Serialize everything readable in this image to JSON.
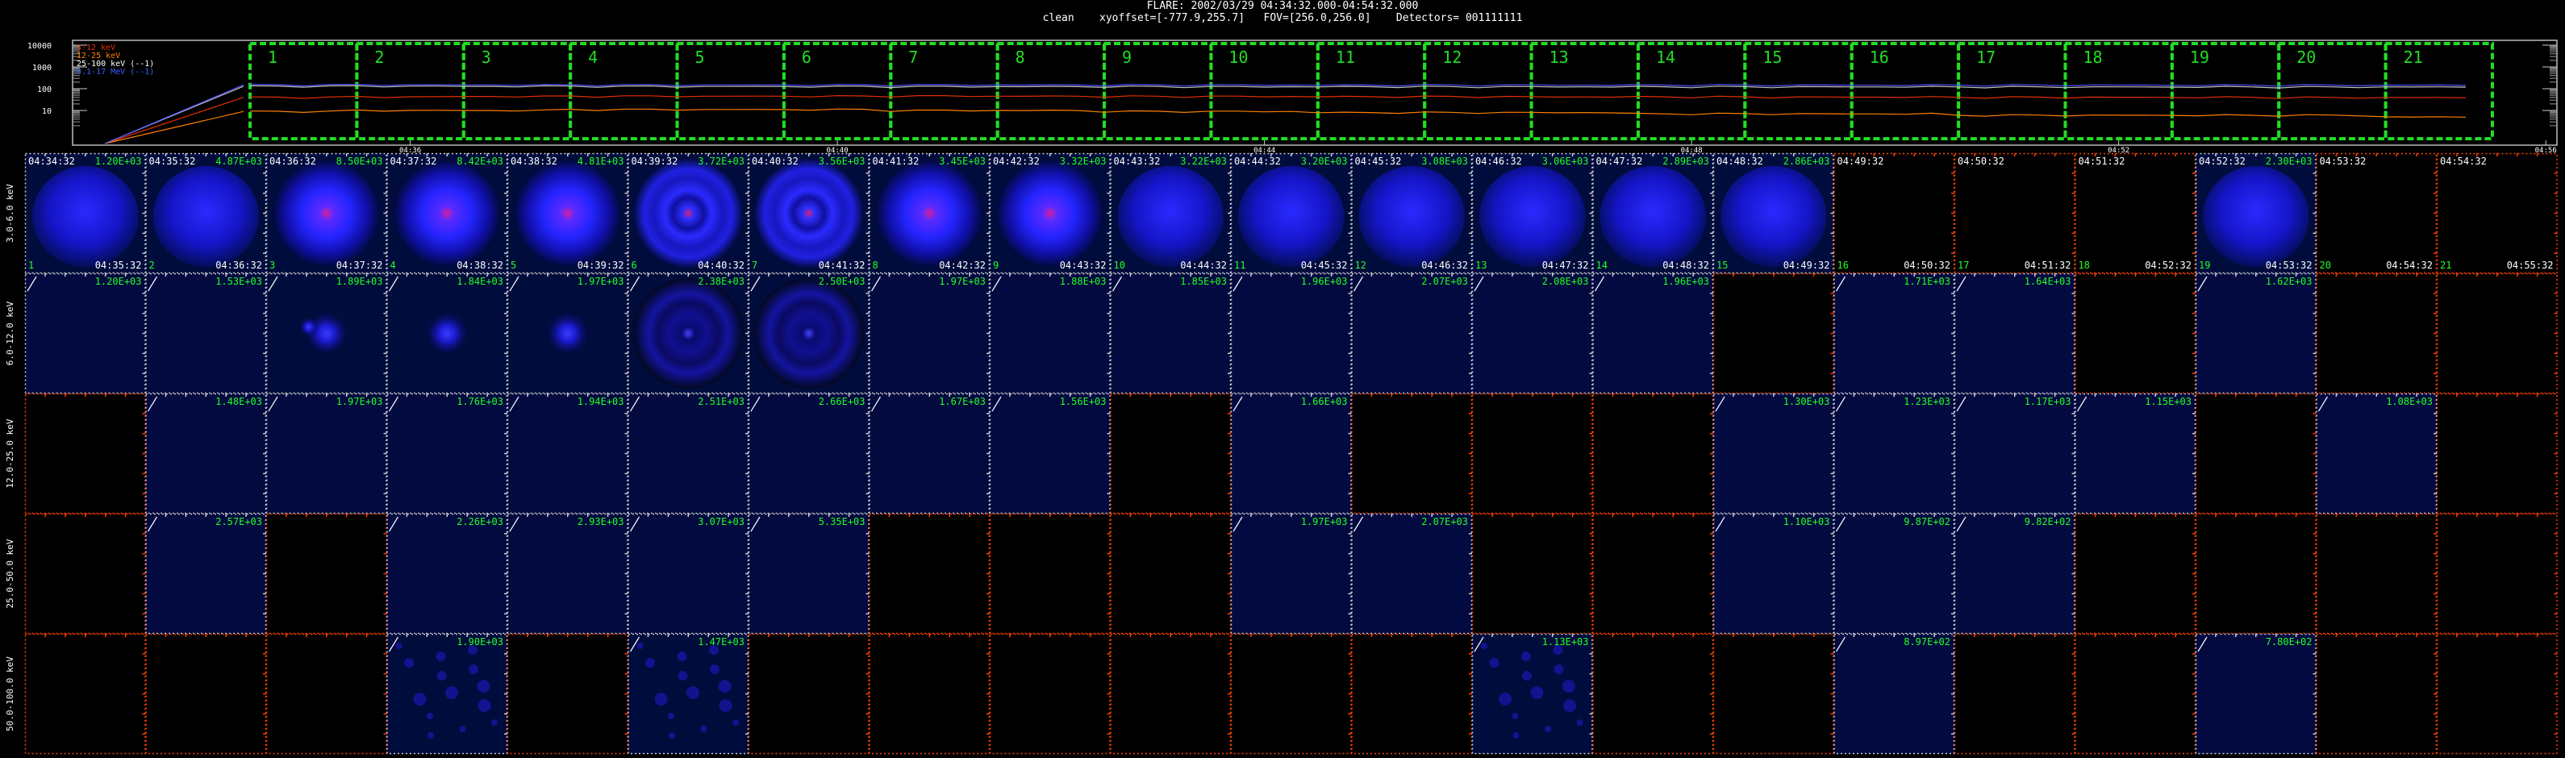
{
  "header": {
    "title": "FLARE: 2002/03/29 04:34:32.000-04:54:32.000",
    "subtitle": "clean    xyoffset=[-777.9,255.7]   FOV=[256.0,256.0]    Detectors= 001111111"
  },
  "lightcurve": {
    "y_ticks": [
      "10000",
      "1000",
      "100",
      "10"
    ],
    "legend": [
      {
        "label": "3-12 keV",
        "color": "#e03000"
      },
      {
        "label": "12-25 keV",
        "color": "#ff8000"
      },
      {
        "label": "25-100 keV (--1)",
        "color": "#ffffff"
      },
      {
        "label": "0.1-17 MeV (--1)",
        "color": "#3060ff"
      }
    ],
    "time_ticks": [
      "04:36",
      "04:40",
      "04:44",
      "04:48",
      "04:52",
      "04:56"
    ],
    "intervals": [
      "1",
      "2",
      "3",
      "4",
      "5",
      "6",
      "7",
      "8",
      "9",
      "10",
      "11",
      "12",
      "13",
      "14",
      "15",
      "16",
      "17",
      "18",
      "19",
      "20",
      "21"
    ],
    "series": [
      {
        "name": "3-12 keV",
        "color": "#e03000",
        "values": [
          40,
          42,
          44,
          45,
          45,
          45,
          46,
          45,
          44,
          44,
          43,
          43,
          42,
          42,
          41,
          41,
          40,
          40,
          40,
          39,
          39
        ]
      },
      {
        "name": "12-25 keV",
        "color": "#ff8000",
        "values": [
          9,
          10,
          10,
          11,
          11,
          11,
          10,
          10,
          9,
          9,
          8,
          8,
          8,
          7,
          7,
          7,
          6,
          6,
          6,
          6,
          5
        ]
      },
      {
        "name": "25-100 keV",
        "color": "#c0c0c0",
        "values": [
          130,
          130,
          128,
          128,
          126,
          126,
          125,
          124,
          124,
          123,
          123,
          122,
          122,
          122,
          121,
          121,
          120,
          120,
          120,
          119,
          119
        ]
      },
      {
        "name": "0.1-17 MeV",
        "color": "#5050ff",
        "values": [
          150,
          150,
          149,
          149,
          148,
          148,
          148,
          147,
          147,
          147,
          146,
          146,
          146,
          146,
          145,
          145,
          145,
          145,
          144,
          144,
          144
        ]
      }
    ]
  },
  "bands": [
    "3.0-6.0 keV",
    "6.0-12.0 keV",
    "12.0-25.0 keV",
    "25.0-50.0 keV",
    "50.0-100.0 keV"
  ],
  "time_starts": [
    "04:34:32",
    "04:35:32",
    "04:36:32",
    "04:37:32",
    "04:38:32",
    "04:39:32",
    "04:40:32",
    "04:41:32",
    "04:42:32",
    "04:43:32",
    "04:44:32",
    "04:45:32",
    "04:46:32",
    "04:47:32",
    "04:48:32",
    "04:49:32",
    "04:50:32",
    "04:51:32",
    "04:52:32",
    "04:53:32",
    "04:54:32"
  ],
  "time_ends": [
    "04:35:32",
    "04:36:32",
    "04:37:32",
    "04:38:32",
    "04:39:32",
    "04:40:32",
    "04:41:32",
    "04:42:32",
    "04:43:32",
    "04:44:32",
    "04:45:32",
    "04:46:32",
    "04:47:32",
    "04:48:32",
    "04:49:32",
    "04:50:32",
    "04:51:32",
    "04:52:32",
    "04:53:32",
    "04:54:32",
    "04:55:32"
  ],
  "colors": {
    "text_green": "#22ff22",
    "box_green": "#22dd22",
    "axis_white": "#cccccc",
    "axis_red": "#ff4000"
  },
  "image_max": [
    [
      "1.20E+03",
      "4.87E+03",
      "8.50E+03",
      "8.42E+03",
      "4.81E+03",
      "3.72E+03",
      "3.56E+03",
      "3.45E+03",
      "3.32E+03",
      "3.22E+03",
      "3.20E+03",
      "3.08E+03",
      "3.06E+03",
      "2.89E+03",
      "2.86E+03",
      "",
      "",
      "",
      "2.30E+03",
      "",
      ""
    ],
    [
      "1.20E+03",
      "1.53E+03",
      "1.89E+03",
      "1.84E+03",
      "1.97E+03",
      "2.38E+03",
      "2.50E+03",
      "1.97E+03",
      "1.88E+03",
      "1.85E+03",
      "1.96E+03",
      "2.07E+03",
      "2.08E+03",
      "1.96E+03",
      "",
      "1.71E+03",
      "1.64E+03",
      "",
      "1.62E+03",
      "",
      ""
    ],
    [
      "",
      "1.48E+03",
      "1.97E+03",
      "1.76E+03",
      "1.94E+03",
      "2.51E+03",
      "2.66E+03",
      "1.67E+03",
      "1.56E+03",
      "",
      "1.66E+03",
      "",
      "",
      "",
      "1.30E+03",
      "1.23E+03",
      "1.17E+03",
      "1.15E+03",
      "",
      "1.08E+03",
      ""
    ],
    [
      "",
      "2.57E+03",
      "",
      "2.26E+03",
      "2.93E+03",
      "3.07E+03",
      "5.35E+03",
      "",
      "",
      "",
      "1.97E+03",
      "2.07E+03",
      "",
      "",
      "1.10E+03",
      "9.87E+02",
      "9.82E+02",
      "",
      "",
      "",
      ""
    ],
    [
      "",
      "",
      "",
      "1.90E+03",
      "",
      "1.47E+03",
      "",
      "",
      "",
      "",
      "",
      "",
      "1.13E+03",
      "",
      "",
      "8.97E+02",
      "",
      "",
      "7.80E+02",
      "",
      ""
    ]
  ],
  "image_kind": [
    [
      "diffuse",
      "diffuse",
      "blob",
      "blob",
      "blob",
      "ring",
      "ring",
      "blob",
      "blob",
      "diffuse",
      "diffuse",
      "diffuse",
      "diffuse",
      "diffuse",
      "diffuse",
      "none",
      "none",
      "none",
      "diffuse",
      "none",
      "none"
    ],
    [
      "faint",
      "faint",
      "dots",
      "dot",
      "dot",
      "ring",
      "ring",
      "faint",
      "faint",
      "faint",
      "faint",
      "faint",
      "faint",
      "faint",
      "none",
      "faint",
      "faint",
      "none",
      "faint",
      "none",
      "none"
    ],
    [
      "none",
      "faint",
      "faint",
      "faint",
      "faint",
      "faint",
      "faint",
      "faint",
      "faint",
      "none",
      "faint",
      "none",
      "none",
      "none",
      "faint",
      "faint",
      "faint",
      "faint",
      "none",
      "faint",
      "none"
    ],
    [
      "none",
      "faint",
      "none",
      "faint",
      "faint",
      "faint",
      "faint",
      "none",
      "none",
      "none",
      "faint",
      "faint",
      "none",
      "none",
      "faint",
      "faint",
      "faint",
      "none",
      "none",
      "none",
      "none"
    ],
    [
      "none",
      "none",
      "none",
      "speckle",
      "none",
      "speckle",
      "none",
      "none",
      "none",
      "none",
      "none",
      "none",
      "speckle",
      "none",
      "none",
      "faint",
      "none",
      "none",
      "faint",
      "none",
      "none"
    ]
  ]
}
